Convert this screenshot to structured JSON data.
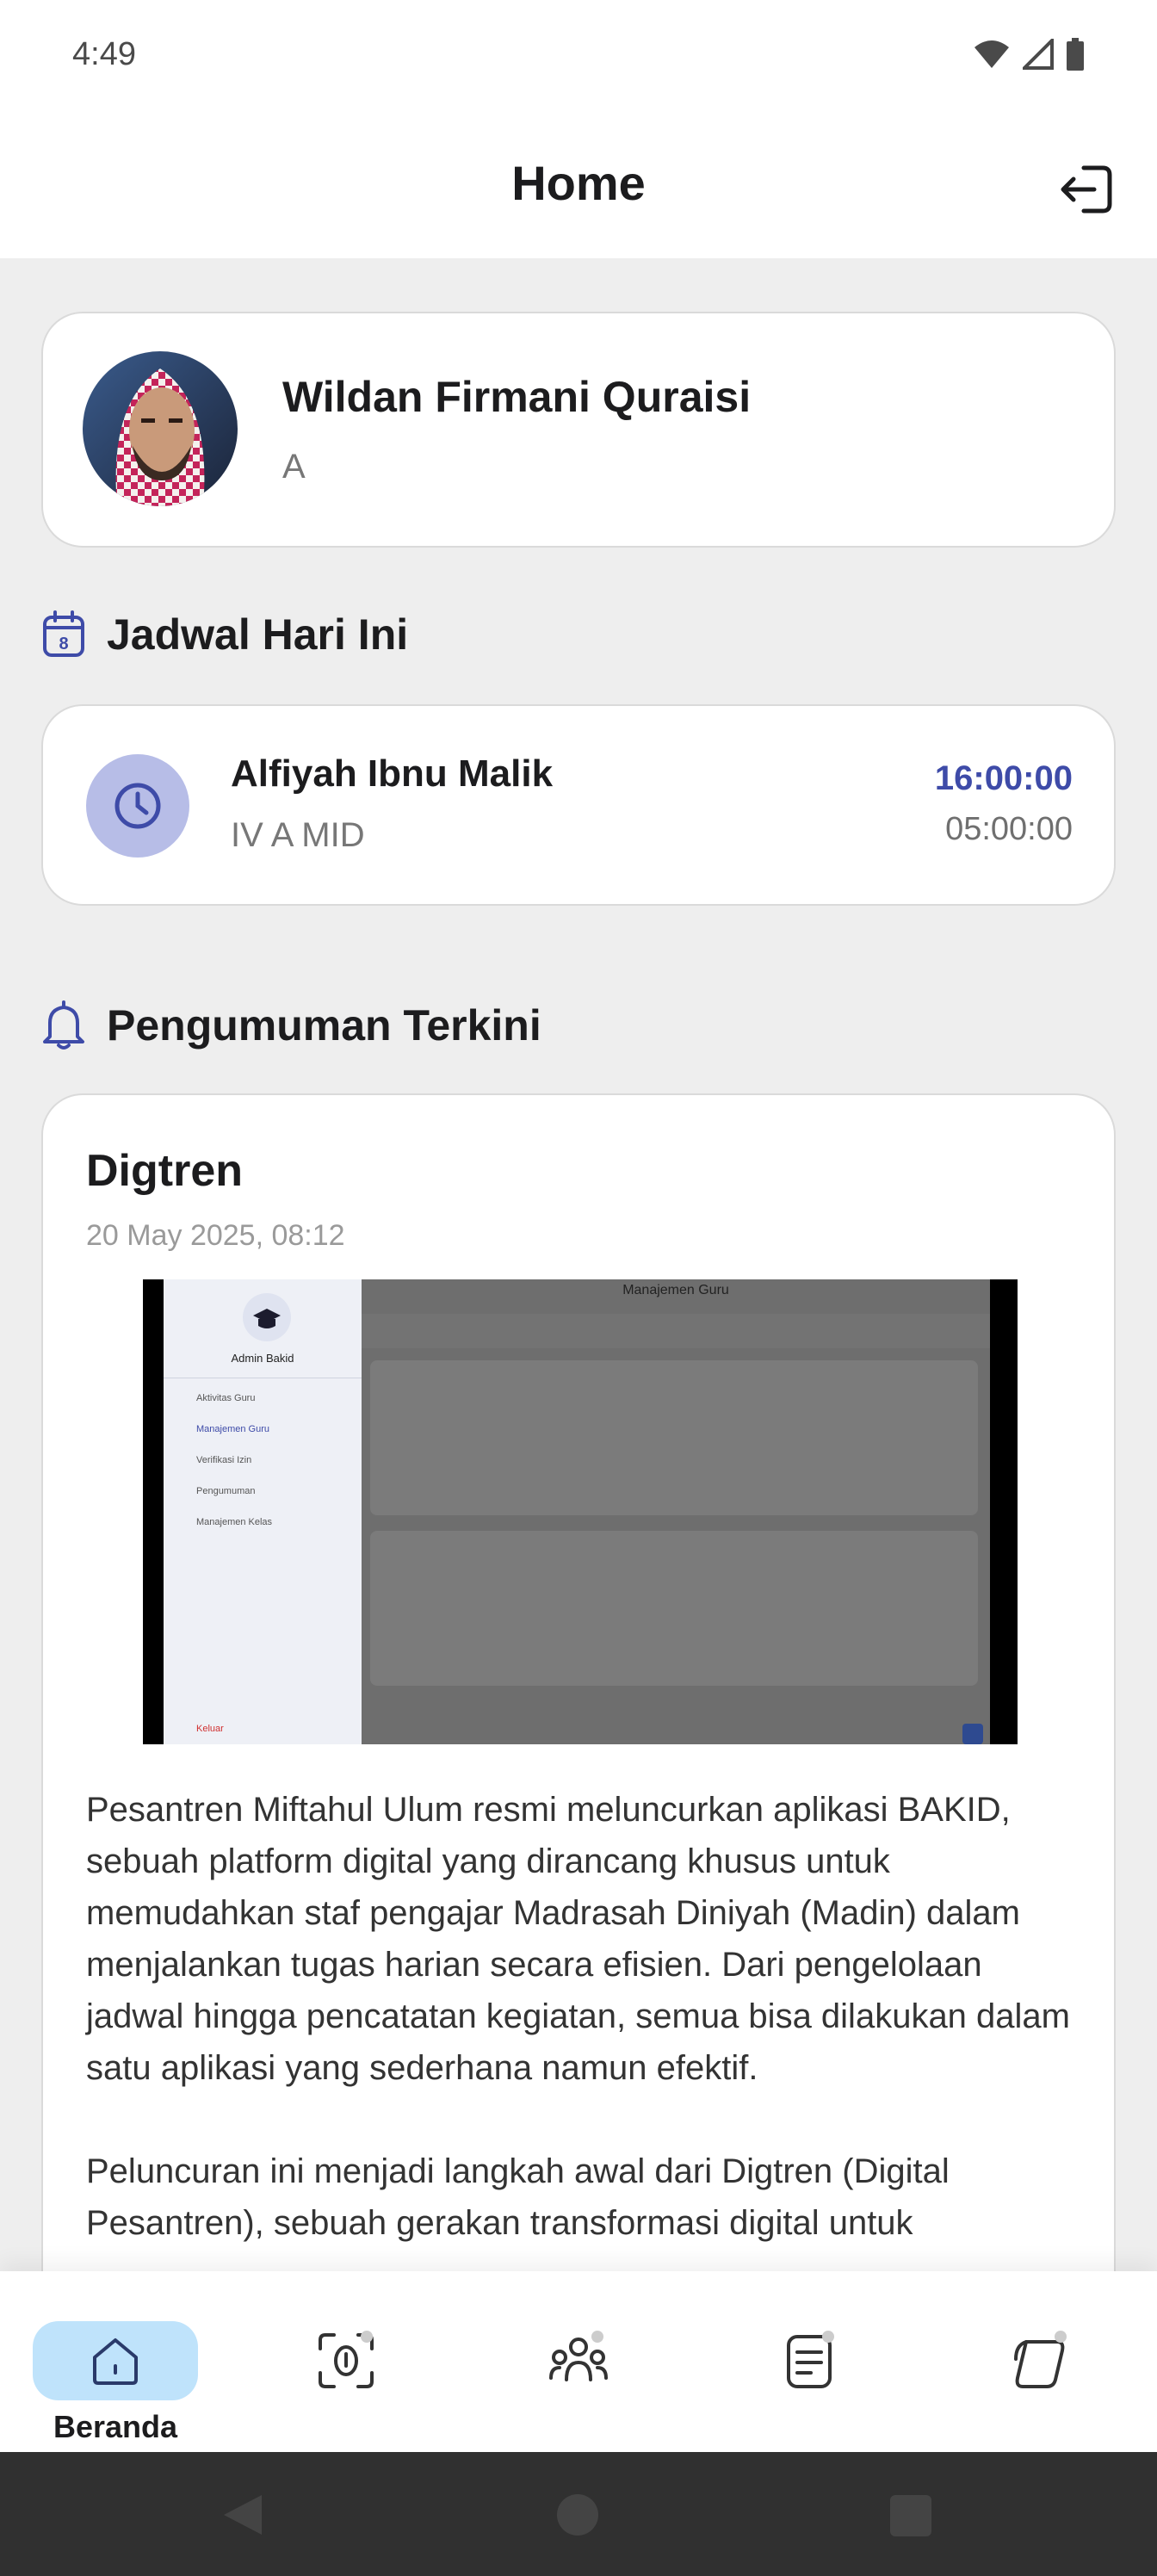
{
  "status_bar": {
    "time": "4:49"
  },
  "app_bar": {
    "title": "Home"
  },
  "profile": {
    "name": "Wildan Firmani Quraisi",
    "class": "A"
  },
  "schedule": {
    "heading": "Jadwal Hari Ini",
    "item": {
      "name": "Alfiyah Ibnu Malik",
      "class": "IV A MID",
      "start": "16:00:00",
      "end": "05:00:00"
    }
  },
  "announcements": {
    "heading": "Pengumuman Terkini",
    "item": {
      "title": "Digtren",
      "date": "20 May 2025, 08:12",
      "image": {
        "screen_title": "Manajemen Guru",
        "sidebar_title": "Admin Bakid",
        "menu": [
          "Aktivitas Guru",
          "Manajemen Guru",
          "Verifikasi Izin",
          "Pengumuman",
          "Manajemen Kelas"
        ],
        "logout": "Keluar"
      },
      "body": [
        "Pesantren Miftahul Ulum resmi meluncurkan aplikasi BAKID, sebuah platform digital yang dirancang khusus untuk memudahkan staf pengajar Madrasah Diniyah (Madin) dalam menjalankan tugas harian secara efisien. Dari pengelolaan jadwal hingga pencatatan kegiatan, semua bisa dilakukan dalam satu aplikasi yang sederhana namun efektif.",
        "Peluncuran ini menjadi langkah awal dari Digtren (Digital Pesantren), sebuah gerakan transformasi digital untuk"
      ]
    }
  },
  "bottom_nav": {
    "items": [
      {
        "label": "Beranda",
        "icon": "home-icon",
        "active": true
      },
      {
        "label": "",
        "icon": "face-scan-icon",
        "active": false
      },
      {
        "label": "",
        "icon": "group-icon",
        "active": false
      },
      {
        "label": "",
        "icon": "document-icon",
        "active": false
      },
      {
        "label": "",
        "icon": "stack-icon",
        "active": false
      }
    ]
  },
  "colors": {
    "accent": "#3e4ba8",
    "nav_active": "#bfe3fb",
    "background": "#eeeeee"
  }
}
